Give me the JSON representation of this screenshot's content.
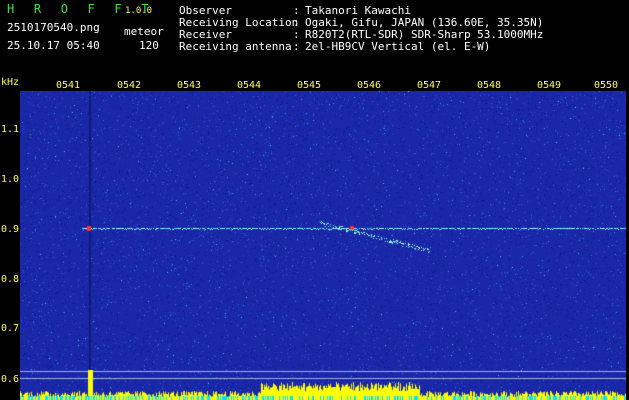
{
  "header": {
    "title": "H R O F F T",
    "version": "1.0.0",
    "filename": "2510170540.png",
    "mode": "meteor",
    "datetime": "25.10.17 05:40",
    "count": "120",
    "fields": [
      {
        "label": "Observer",
        "sep": ":",
        "value": "Takanori Kawachi"
      },
      {
        "label": "Receiving Location",
        "sep": ":",
        "value": "Ogaki, Gifu, JAPAN (136.60E, 35.35N)"
      },
      {
        "label": "Receiver",
        "sep": ":",
        "value": "R820T2(RTL-SDR) SDR-Sharp 53.1000MHz"
      },
      {
        "label": "Receiving antenna",
        "sep": ":",
        "value": "2el-HB9CV Vertical (el. E-W)"
      }
    ]
  },
  "axis": {
    "unit": "kHz",
    "time_labels": [
      "0541",
      "0542",
      "0543",
      "0544",
      "0545",
      "0546",
      "0547",
      "0548",
      "0549",
      "0550"
    ],
    "freq_labels": [
      "1.1",
      "1.0",
      "0.9",
      "0.8",
      "0.7",
      "0.6"
    ]
  },
  "colors": {
    "background": "#000000",
    "header_text": "#ffffff",
    "title_green": "#3ee03e",
    "label_yellow": "#ffff40",
    "waterfall_base": "#1a28a8",
    "signal_cyan": "#a0ffff",
    "meteor_red": "#ff3030",
    "spectrum_yellow": "#ffff00",
    "spectrum_cyan": "#00e5ff"
  }
}
